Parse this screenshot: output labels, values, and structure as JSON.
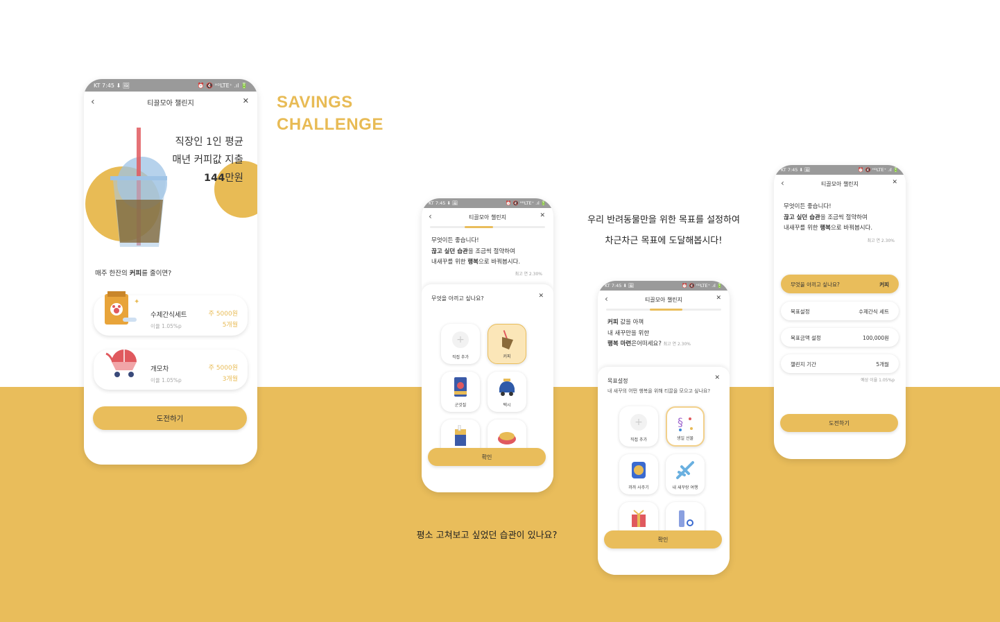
{
  "heading": {
    "line1": "SAVINGS",
    "line2": "CHALLENGE"
  },
  "captions": {
    "pet_line1": "우리 반려동물만을 위한 목표를 설정하여",
    "pet_line2": "차근차근 목표에 도달해봅시다!",
    "habit": "평소 고쳐보고 싶었던 습관이 있나요?"
  },
  "status": {
    "left": "KT 7:45 ⬇ 🖼",
    "right": "⏰ 🔇 ᴴᴰLTE⁺ .ıl 🔋"
  },
  "app_title": "티끌모아 챌린지",
  "colors": {
    "accent": "#e9bd5b",
    "accent_text": "#e8bb55",
    "status_bar": "#9a9a9a"
  },
  "phone1": {
    "headline_l1": "직장인 1인 평균",
    "headline_l2": "매년 커피값 지출",
    "headline_amount": "144",
    "headline_unit": "만원",
    "question_a": "매주 한잔의 ",
    "question_b": "커피",
    "question_c": "를 줄이면?",
    "cards": [
      {
        "name": "수제간식세트",
        "rate": "이율 1.05%p",
        "weekly": "주 5000원",
        "months": "5개월",
        "icon": "pet-food-bag-icon"
      },
      {
        "name": "개모차",
        "rate": "이율 1.05%p",
        "weekly": "주 5000원",
        "months": "3개월",
        "icon": "pet-stroller-icon"
      }
    ],
    "cta": "도전하기"
  },
  "intro": {
    "l1": "무엇이든 좋습니다!",
    "l2_bold": "끊고 싶던 습관",
    "l2_rest": "을 조금씩 절약하여",
    "l3_a": "내새꾸를 위한 ",
    "l3_bold": "행복",
    "l3_c": "으로 바꿔봅시다.",
    "rate_note": "최고 연 2.30%"
  },
  "phone2": {
    "sheet_title": "무엇을 아끼고 싶나요?",
    "tiles": [
      {
        "label": "직접 추가",
        "icon": "plus-icon"
      },
      {
        "label": "커피",
        "icon": "coffee-icon"
      },
      {
        "label": "군것질",
        "icon": "snack-icon"
      },
      {
        "label": "택시",
        "icon": "taxi-icon"
      },
      {
        "label": "",
        "icon": "cigarette-icon"
      },
      {
        "label": "",
        "icon": "food-bowl-icon"
      }
    ],
    "confirm": "확인"
  },
  "phone3": {
    "intro_l1_bold": "커피",
    "intro_l1_rest": " 값을 아껴",
    "intro_l2": "내 새꾸만을 위한",
    "intro_l3_bold": "행복 마련",
    "intro_l3_rest": "은어떠세요?",
    "rate_note": "최고 연 2.30%",
    "sheet_title": "목표설정",
    "sheet_sub": "내 새꾸의 어떤 행복을 위해 티끌을 모으고 싶나요?",
    "tiles": [
      {
        "label": "직접 추가",
        "icon": "plus-icon"
      },
      {
        "label": "생일 선물",
        "icon": "confetti-icon"
      },
      {
        "label": "까까 사주기",
        "icon": "treat-can-icon"
      },
      {
        "label": "내 새꾸랑 여행",
        "icon": "airplane-icon"
      },
      {
        "label": "",
        "icon": "gift-icon"
      },
      {
        "label": "",
        "icon": "grooming-icon"
      }
    ],
    "confirm": "확인"
  },
  "phone4": {
    "fields": [
      {
        "key": "무엇을 아끼고 싶나요?",
        "value": "커피"
      },
      {
        "key": "목표설정",
        "value": "수제간식 세트"
      },
      {
        "key": "목표금액 설정",
        "value": "100,000원"
      },
      {
        "key": "챌린지 기간",
        "value": "5개월"
      }
    ],
    "expected": "예상 이율 1.05%p",
    "cta": "도전하기"
  }
}
